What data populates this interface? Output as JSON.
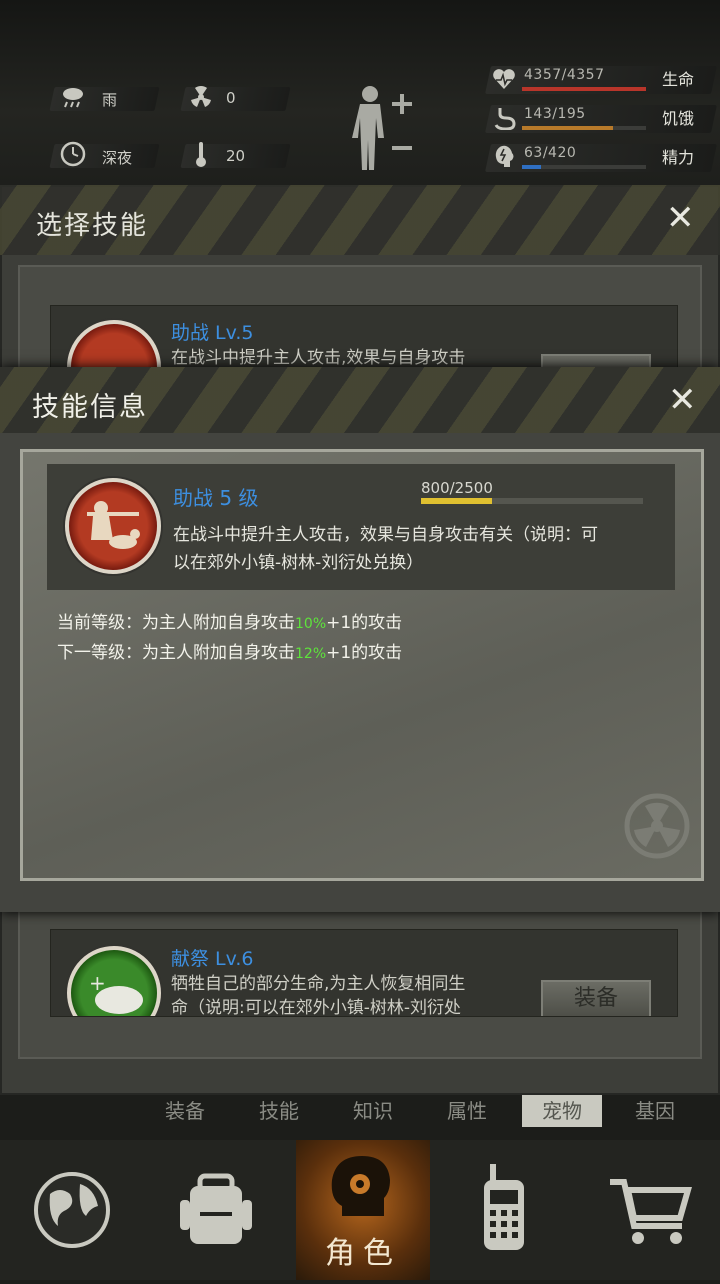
{
  "status": {
    "weather": "雨",
    "radiation": "0",
    "time_of_day": "深夜",
    "temperature": "20",
    "stats": [
      {
        "value": "4357/4357",
        "label": "生命",
        "color": "#b8352a",
        "fill": 1.0
      },
      {
        "value": "143/195",
        "label": "饥饿",
        "color": "#b87a2a",
        "fill": 0.733
      },
      {
        "value": "63/420",
        "label": "精力",
        "color": "#2f6fc2",
        "fill": 0.15
      }
    ]
  },
  "skill_select": {
    "title": "选择技能",
    "items": [
      {
        "name": "助战 Lv.5",
        "desc_line1": "在战斗中提升主人攻击,效果与自身攻击"
      },
      {
        "name": "献祭 Lv.6",
        "desc_line1": "牺牲自己的部分生命,为主人恢复相同生",
        "desc_line2": "命（说明:可以在郊外小镇-树林-刘衍处",
        "button": "装备"
      }
    ]
  },
  "skill_info": {
    "title": "技能信息",
    "name": "助战 5 级",
    "progress_text": "800/2500",
    "progress": 0.32,
    "desc_line1": "在战斗中提升主人攻击，效果与自身攻击有关（说明：可",
    "desc_line2": "以在郊外小镇-树林-刘衍处兑换）",
    "current": {
      "prefix": "当前等级：为主人附加自身攻击",
      "percent": "10%",
      "suffix": "+1的攻击"
    },
    "next": {
      "prefix": "下一等级：为主人附加自身攻击",
      "percent": "12%",
      "suffix": "+1的攻击"
    }
  },
  "tabs": [
    "装备",
    "技能",
    "知识",
    "属性",
    "宠物",
    "基因"
  ],
  "nav": {
    "active_label": "角色"
  },
  "colors": {
    "accent_blue": "#3d8fe0",
    "green": "#5ee33c",
    "progress": "#e0c030"
  }
}
